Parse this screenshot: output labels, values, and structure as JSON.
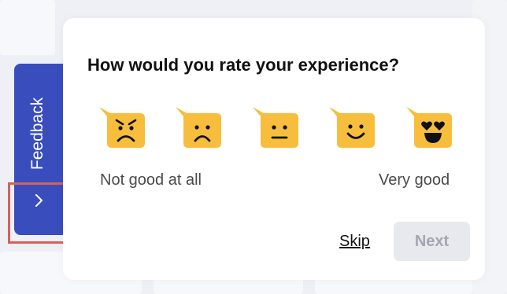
{
  "feedback_tab": {
    "label": "Feedback",
    "chevron_icon": "chevron-right-icon",
    "color": "#3a4dbd"
  },
  "highlight": {
    "color": "#d9605a"
  },
  "survey": {
    "title": "How would you rate your experience?",
    "ratings": [
      {
        "icon": "angry-face-icon",
        "value": 1
      },
      {
        "icon": "sad-face-icon",
        "value": 2
      },
      {
        "icon": "neutral-face-icon",
        "value": 3
      },
      {
        "icon": "smile-face-icon",
        "value": 4
      },
      {
        "icon": "heart-eyes-face-icon",
        "value": 5
      }
    ],
    "scale_low_label": "Not good at all",
    "scale_high_label": "Very good",
    "skip_label": "Skip",
    "next_label": "Next",
    "emoji_color": "#f7be3e"
  }
}
